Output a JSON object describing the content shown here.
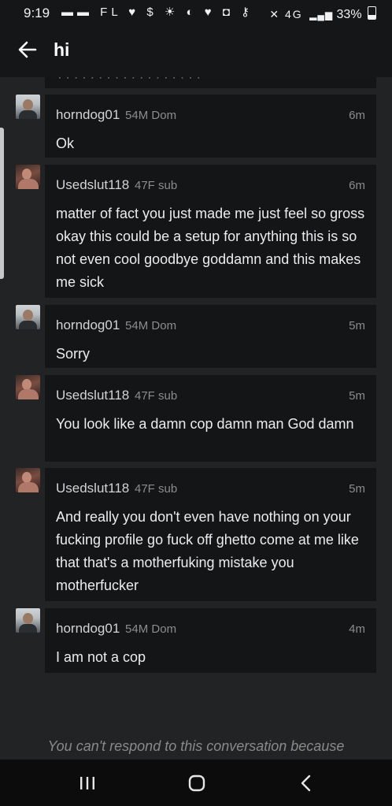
{
  "status_bar": {
    "time": "9:19",
    "left_icons": "▬▬ FL ♥ $ ☀ ◐ ♥ ◘ ⚷",
    "signal": "✕ 4G",
    "battery_label": "33%"
  },
  "header": {
    "title": "hi"
  },
  "messages": [
    {
      "user": "horndog01",
      "info": "54M Dom",
      "time": "6m",
      "text": "Ok",
      "avatar": "male-avatar"
    },
    {
      "user": "Usedslut118",
      "info": "47F sub",
      "time": "6m",
      "text": "matter of fact you just made me just feel so gross okay this could be a setup for anything this is so not even cool goodbye goddamn and this makes me sick",
      "avatar": "female-avatar"
    },
    {
      "user": "horndog01",
      "info": "54M Dom",
      "time": "5m",
      "text": "Sorry",
      "avatar": "male-avatar"
    },
    {
      "user": "Usedslut118",
      "info": "47F sub",
      "time": "5m",
      "text": "You look like a damn cop damn man God damn",
      "avatar": "female-avatar"
    },
    {
      "user": "Usedslut118",
      "info": "47F sub",
      "time": "5m",
      "text": "And really you don't even have nothing on your fucking profile go fuck off ghetto come at me like that that's a motherfuking mistake you motherfucker",
      "avatar": "female-avatar"
    },
    {
      "user": "horndog01",
      "info": "54M Dom",
      "time": "4m",
      "text": "I am not a cop",
      "avatar": "male-avatar"
    }
  ],
  "notice": "You can't respond to this conversation because",
  "nav": {
    "recent": "recent-apps-icon",
    "home": "home-icon",
    "back": "back-icon"
  }
}
